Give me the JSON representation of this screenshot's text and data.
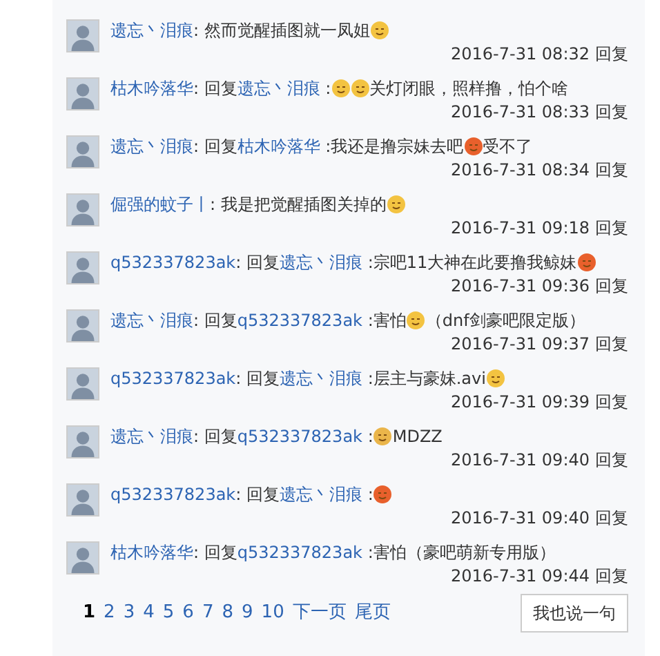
{
  "comments": [
    {
      "content": [
        {
          "kind": "link",
          "text": "遗忘丶泪痕"
        },
        {
          "kind": "text",
          "text": ": 然而觉醒插图就一凤姐"
        },
        {
          "kind": "emoticon",
          "color": "#f3c341"
        }
      ],
      "time": "2016-7-31 08:32",
      "reply": "回复"
    },
    {
      "content": [
        {
          "kind": "link",
          "text": "枯木吟落华"
        },
        {
          "kind": "text",
          "text": ": 回复"
        },
        {
          "kind": "link",
          "text": "遗忘丶泪痕"
        },
        {
          "kind": "text",
          "text": " :"
        },
        {
          "kind": "emoticon",
          "color": "#f3c341"
        },
        {
          "kind": "emoticon",
          "color": "#f3c341"
        },
        {
          "kind": "text",
          "text": "关灯闭眼，照样撸，怕个啥"
        }
      ],
      "time": "2016-7-31 08:33",
      "reply": "回复"
    },
    {
      "content": [
        {
          "kind": "link",
          "text": "遗忘丶泪痕"
        },
        {
          "kind": "text",
          "text": ": 回复"
        },
        {
          "kind": "link",
          "text": "枯木吟落华"
        },
        {
          "kind": "text",
          "text": " :我还是撸宗妹去吧"
        },
        {
          "kind": "emoticon",
          "color": "#e8602c"
        },
        {
          "kind": "text",
          "text": "受不了"
        }
      ],
      "time": "2016-7-31 08:34",
      "reply": "回复"
    },
    {
      "content": [
        {
          "kind": "link",
          "text": "倔强的蚊子丨"
        },
        {
          "kind": "text",
          "text": ": 我是把觉醒插图关掉的"
        },
        {
          "kind": "emoticon",
          "color": "#f3c341"
        }
      ],
      "time": "2016-7-31 09:18",
      "reply": "回复"
    },
    {
      "content": [
        {
          "kind": "link",
          "text": "q532337823ak"
        },
        {
          "kind": "text",
          "text": ": 回复"
        },
        {
          "kind": "link",
          "text": "遗忘丶泪痕"
        },
        {
          "kind": "text",
          "text": " :宗吧11大神在此要撸我鲸妹"
        },
        {
          "kind": "emoticon",
          "color": "#e8602c"
        }
      ],
      "time": "2016-7-31 09:36",
      "reply": "回复"
    },
    {
      "content": [
        {
          "kind": "link",
          "text": "遗忘丶泪痕"
        },
        {
          "kind": "text",
          "text": ": 回复"
        },
        {
          "kind": "link",
          "text": "q532337823ak"
        },
        {
          "kind": "text",
          "text": " :害怕"
        },
        {
          "kind": "emoticon",
          "color": "#f3c341"
        },
        {
          "kind": "text",
          "text": "（dnf剑豪吧限定版）"
        }
      ],
      "time": "2016-7-31 09:37",
      "reply": "回复"
    },
    {
      "content": [
        {
          "kind": "link",
          "text": "q532337823ak"
        },
        {
          "kind": "text",
          "text": ": 回复"
        },
        {
          "kind": "link",
          "text": "遗忘丶泪痕"
        },
        {
          "kind": "text",
          "text": " :层主与豪妹.avi"
        },
        {
          "kind": "emoticon",
          "color": "#f3c341"
        }
      ],
      "time": "2016-7-31 09:39",
      "reply": "回复"
    },
    {
      "content": [
        {
          "kind": "link",
          "text": "遗忘丶泪痕"
        },
        {
          "kind": "text",
          "text": ": 回复"
        },
        {
          "kind": "link",
          "text": "q532337823ak"
        },
        {
          "kind": "text",
          "text": " :"
        },
        {
          "kind": "emoticon",
          "color": "#eab54a"
        },
        {
          "kind": "text",
          "text": "MDZZ"
        }
      ],
      "time": "2016-7-31 09:40",
      "reply": "回复"
    },
    {
      "content": [
        {
          "kind": "link",
          "text": "q532337823ak"
        },
        {
          "kind": "text",
          "text": ": 回复"
        },
        {
          "kind": "link",
          "text": "遗忘丶泪痕"
        },
        {
          "kind": "text",
          "text": " :"
        },
        {
          "kind": "emoticon",
          "color": "#e8602c"
        }
      ],
      "time": "2016-7-31 09:40",
      "reply": "回复"
    },
    {
      "content": [
        {
          "kind": "link",
          "text": "枯木吟落华"
        },
        {
          "kind": "text",
          "text": ": 回复"
        },
        {
          "kind": "link",
          "text": "q532337823ak"
        },
        {
          "kind": "text",
          "text": " :害怕（豪吧萌新专用版）"
        }
      ],
      "time": "2016-7-31 09:44",
      "reply": "回复"
    }
  ],
  "pagination": [
    {
      "label": "1",
      "selected": true
    },
    {
      "label": "2",
      "selected": false
    },
    {
      "label": "3",
      "selected": false
    },
    {
      "label": "4",
      "selected": false
    },
    {
      "label": "5",
      "selected": false
    },
    {
      "label": "6",
      "selected": false
    },
    {
      "label": "7",
      "selected": false
    },
    {
      "label": "8",
      "selected": false
    },
    {
      "label": "9",
      "selected": false
    },
    {
      "label": "10",
      "selected": false
    },
    {
      "label": "下一页",
      "selected": false
    },
    {
      "label": "尾页",
      "selected": false
    }
  ],
  "say_button": "我也说一句"
}
